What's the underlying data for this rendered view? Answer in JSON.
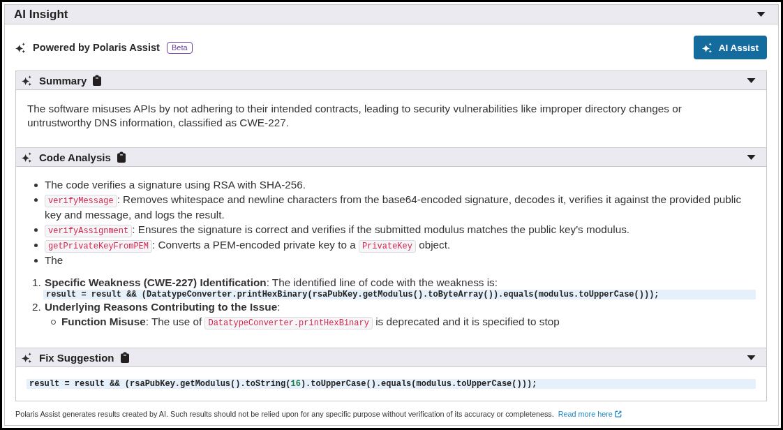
{
  "panel": {
    "title": "AI Insight",
    "expanded": true
  },
  "powered_by": {
    "label": "Powered by Polaris Assist",
    "badge": "Beta"
  },
  "assist_button": {
    "label": "AI Assist"
  },
  "sections": [
    {
      "kind": "paragraph",
      "title": "Summary",
      "expanded": true,
      "text": "The software misuses APIs by not adhering to their intended contracts, leading to security vulnerabilities like improper directory changes or untrustworthy DNS information, classified as CWE-227."
    },
    {
      "kind": "analysis",
      "title": "Code Analysis",
      "expanded": true,
      "bullets": [
        {
          "segments": [
            {
              "kind": "text",
              "text": "The code verifies a signature using RSA with SHA-256."
            }
          ]
        },
        {
          "segments": [
            {
              "kind": "code",
              "text": "verifyMessage"
            },
            {
              "kind": "text",
              "text": ": Removes whitespace and newline characters from the base64-encoded signature, decodes it, verifies it against the provided public key and message, and logs the result."
            }
          ]
        },
        {
          "segments": [
            {
              "kind": "code",
              "text": "verifyAssignment"
            },
            {
              "kind": "text",
              "text": ": Ensures the signature is correct and verifies if the submitted modulus matches the public key's modulus."
            }
          ]
        },
        {
          "segments": [
            {
              "kind": "code",
              "text": "getPrivateKeyFromPEM"
            },
            {
              "kind": "text",
              "text": ": Converts a PEM-encoded private key to a "
            },
            {
              "kind": "code",
              "text": "PrivateKey"
            },
            {
              "kind": "text",
              "text": " object."
            }
          ]
        },
        {
          "segments": [
            {
              "kind": "text",
              "text": "The"
            }
          ]
        }
      ],
      "numbered": [
        {
          "number": "1.",
          "text": "**Specific Weakness (CWE-227) Identification**: The identified line of code with the weakness is:",
          "code": [
            {
              "kind": "plain",
              "text": "result = result && (DatatypeConverter.printHexBinary(rsaPubKey.getModulus().toByteArray()).equals(modulus.toUpperCase()));"
            }
          ]
        },
        {
          "number": "2.",
          "text": "**Underlying Reasons Contributing to the Issue**:",
          "children": [
            {
              "segments": [
                {
                  "kind": "text",
                  "text": "**Function Misuse**: The use of "
                },
                {
                  "kind": "code",
                  "text": "DatatypeConverter.printHexBinary"
                },
                {
                  "kind": "text",
                  "text": " is deprecated and it is specified to stop"
                }
              ]
            }
          ]
        }
      ]
    },
    {
      "kind": "code",
      "title": "Fix Suggestion",
      "expanded": true,
      "code": [
        {
          "kind": "plain",
          "text": "result = result && (rsaPubKey.getModulus().toString("
        },
        {
          "kind": "number",
          "text": "16"
        },
        {
          "kind": "plain",
          "text": ").toUpperCase().equals(modulus.toUpperCase()));"
        }
      ]
    }
  ],
  "disclaimer": {
    "text": "Polaris Assist generates results created by AI. Such results should not be relied upon for any specific purpose without verification of its accuracy or completeness.",
    "link": "Read more here"
  }
}
